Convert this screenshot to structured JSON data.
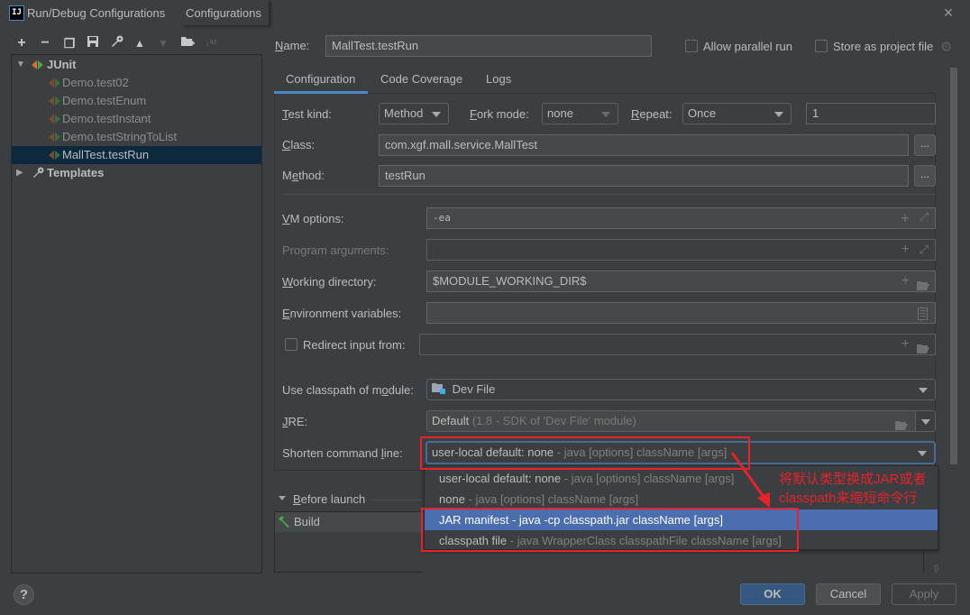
{
  "window": {
    "app_icon": "IJ",
    "title": "Run/Debug Configurations",
    "tooltip_tab": "Configurations",
    "close_icon": "×"
  },
  "toolbar": {
    "add": "+",
    "remove": "−",
    "copy": "❐",
    "save": "🖫",
    "edit_defaults": "🔧",
    "move_up": "▲",
    "move_down": "▼",
    "new_folder": "📁",
    "sort": "↓ᵃᶻ"
  },
  "tree": {
    "junit_label": "JUnit",
    "items": [
      {
        "label": "Demo.test02",
        "temporary": true
      },
      {
        "label": "Demo.testEnum",
        "temporary": true
      },
      {
        "label": "Demo.testInstant",
        "temporary": true
      },
      {
        "label": "Demo.testStringToList",
        "temporary": true
      },
      {
        "label": "MallTest.testRun",
        "selected": true
      }
    ],
    "templates_label": "Templates"
  },
  "header": {
    "name_label": "Name:",
    "name_value": "MallTest.testRun",
    "allow_parallel_label": "Allow parallel run",
    "allow_parallel_checked": false,
    "store_project_label": "Store as project file",
    "store_project_checked": false
  },
  "tabs": [
    {
      "label": "Configuration",
      "active": true
    },
    {
      "label": "Code Coverage"
    },
    {
      "label": "Logs"
    }
  ],
  "config": {
    "test_kind_label": "Test kind:",
    "test_kind_value": "Method",
    "fork_mode_label": "Fork mode:",
    "fork_mode_value": "none",
    "repeat_label": "Repeat:",
    "repeat_value": "Once",
    "repeat_count": "1",
    "class_label": "Class:",
    "class_value": "com.xgf.mall.service.MallTest",
    "method_label": "Method:",
    "method_value": "testRun",
    "browse_label": "...",
    "vm_options_label": "VM options:",
    "vm_options_value": "-ea",
    "program_args_label": "Program arguments:",
    "program_args_value": "",
    "working_dir_label": "Working directory:",
    "working_dir_value": "$MODULE_WORKING_DIR$",
    "env_vars_label": "Environment variables:",
    "env_vars_value": "",
    "redirect_label": "Redirect input from:",
    "redirect_checked": false,
    "redirect_value": "",
    "classpath_label": "Use classpath of module:",
    "classpath_value": "Dev File",
    "jre_label": "JRE:",
    "jre_value": "Default",
    "jre_hint": "(1.8 - SDK of 'Dev File' module)",
    "shorten_label": "Shorten command line:",
    "shorten_value": "user-local default: none",
    "shorten_hint": "- java [options] className [args]"
  },
  "shorten_options": [
    {
      "label": "user-local default: none",
      "hint": "- java [options] className [args]"
    },
    {
      "label": "none",
      "hint": "- java [options] className [args]"
    },
    {
      "label": "JAR manifest",
      "hint": "- java -cp classpath.jar className [args]",
      "selected": true
    },
    {
      "label": "classpath file",
      "hint": "- java WrapperClass classpathFile className [args]"
    }
  ],
  "annotation": {
    "line1": "将默认类型换成JAR或者",
    "line2": "classpath来缩短命令行",
    "color": "#e8212b"
  },
  "before_launch": {
    "label": "Before launch",
    "tasks": [
      {
        "label": "Build"
      }
    ]
  },
  "buttons": {
    "ok": "OK",
    "cancel": "Cancel",
    "apply": "Apply",
    "help": "?"
  },
  "colors": {
    "background": "#3c3f41",
    "selection": "#4b6eaf",
    "tree_selection": "#0d293e",
    "tab_underline": "#4a88c7",
    "ok_button": "#365880"
  }
}
